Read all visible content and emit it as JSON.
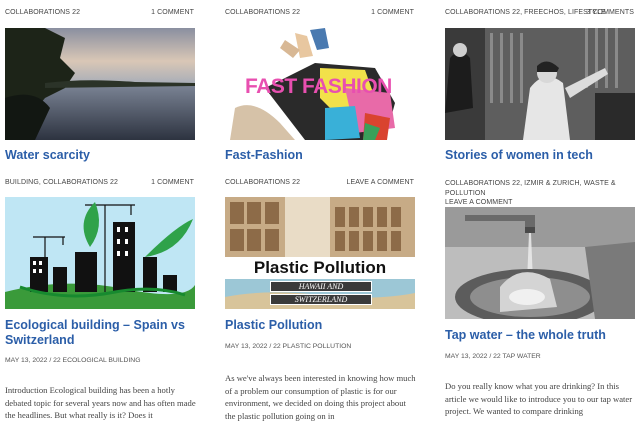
{
  "posts": [
    {
      "categories": "COLLABORATIONS 22",
      "comments": "1 COMMENT",
      "title": "Water scarcity",
      "image": "lake-sunset-image"
    },
    {
      "categories": "COLLABORATIONS 22",
      "comments": "1 COMMENT",
      "title": "Fast-Fashion",
      "image": "fast-fashion-collage",
      "image_text": "FAST FASHION"
    },
    {
      "categories": "COLLABORATIONS 22, FREECHOS, LIFESTYLE",
      "comments": "3 COMMENTS",
      "title": "Stories of women in tech",
      "image": "women-computer-operators-photo"
    },
    {
      "categories": "BUILDING, COLLABORATIONS 22",
      "comments": "1 COMMENT",
      "title": "Ecological building – Spain vs Switzerland",
      "image": "eco-city-illustration",
      "byline": "MAY 13, 2022 / 22 ECOLOGICAL BUILDING",
      "excerpt": "Introduction  Ecological building has been a hotly debated topic for several years now and has often made the headlines. But what really is it? Does it"
    },
    {
      "categories": "COLLABORATIONS 22",
      "comments": "LEAVE A COMMENT",
      "title": "Plastic Pollution",
      "image": "plastic-pollution-banner",
      "image_text": "Plastic Pollution",
      "image_subtext_1": "HAWAII AND",
      "image_subtext_2": "SWITZERLAND",
      "byline": "MAY 13, 2022 / 22 PLASTIC POLLUTION",
      "excerpt": "As we've always been interested in knowing how much of a problem our consumption of plastic is for our environment, we decided on doing this project about the plastic pollution going on in"
    },
    {
      "categories": "COLLABORATIONS 22, IZMIR & ZURICH, WASTE & POLLUTION",
      "comments": "LEAVE A COMMENT",
      "title": "Tap water – the whole truth",
      "image": "tap-water-sink-photo",
      "byline": "MAY 13, 2022 / 22 TAP WATER",
      "excerpt": "Do you really know what you are drinking? In this article we would like to introduce you to our tap water project. We wanted to compare drinking"
    }
  ],
  "colors": {
    "title": "#2b5ea8",
    "meta": "#444444",
    "excerpt": "#444444"
  }
}
